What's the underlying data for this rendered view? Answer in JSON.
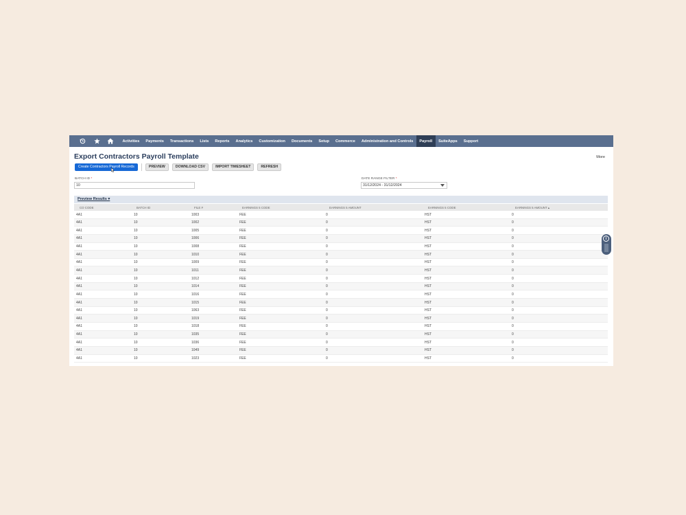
{
  "nav": {
    "icons": [
      "recent-icon",
      "star-icon",
      "home-icon"
    ],
    "items": [
      {
        "label": "Activities",
        "active": false
      },
      {
        "label": "Payments",
        "active": false
      },
      {
        "label": "Transactions",
        "active": false
      },
      {
        "label": "Lists",
        "active": false
      },
      {
        "label": "Reports",
        "active": false
      },
      {
        "label": "Analytics",
        "active": false
      },
      {
        "label": "Customization",
        "active": false
      },
      {
        "label": "Documents",
        "active": false
      },
      {
        "label": "Setup",
        "active": false
      },
      {
        "label": "Commerce",
        "active": false
      },
      {
        "label": "Administration and Controls",
        "active": false
      },
      {
        "label": "Payroll",
        "active": true
      },
      {
        "label": "SuiteApps",
        "active": false
      },
      {
        "label": "Support",
        "active": false
      }
    ]
  },
  "page": {
    "title": "Export Contractors Payroll Template",
    "more": "More"
  },
  "buttons": {
    "create": "Create Contractors Payroll Records",
    "preview": "PREVIEW",
    "download": "DOWNLOAD CSV",
    "import": "IMPORT TIMESHEET",
    "refresh": "REFRESH"
  },
  "fields": {
    "batch_id_label": "BATCH ID",
    "batch_id_value": "10",
    "date_range_label": "DATE RANGE FILTER",
    "date_range_value": "31/12/2024 - 31/12/2024",
    "required_mark": "*"
  },
  "preview": {
    "title": "Preview Results",
    "title_caret": "▾",
    "columns": [
      "CO CODE",
      "BATCH ID",
      "FILE #",
      "EARNINGS 5 CODE",
      "EARNINGS 5 AMOUNT",
      "EARNINGS 5 CODE",
      "EARNINGS 5 AMOUNT ▴"
    ],
    "rows": [
      [
        "4A1",
        "10",
        "1003",
        "FEE",
        "0",
        "HST",
        "0"
      ],
      [
        "4A1",
        "10",
        "1002",
        "FEE",
        "0",
        "HST",
        "0"
      ],
      [
        "4A1",
        "10",
        "1005",
        "FEE",
        "0",
        "HST",
        "0"
      ],
      [
        "4A1",
        "10",
        "1006",
        "FEE",
        "0",
        "HST",
        "0"
      ],
      [
        "4A1",
        "10",
        "1008",
        "FEE",
        "0",
        "HST",
        "0"
      ],
      [
        "4A1",
        "10",
        "1010",
        "FEE",
        "0",
        "HST",
        "0"
      ],
      [
        "4A1",
        "10",
        "1009",
        "FEE",
        "0",
        "HST",
        "0"
      ],
      [
        "4A1",
        "10",
        "1011",
        "FEE",
        "0",
        "HST",
        "0"
      ],
      [
        "4A1",
        "10",
        "1012",
        "FEE",
        "0",
        "HST",
        "0"
      ],
      [
        "4A1",
        "10",
        "1014",
        "FEE",
        "0",
        "HST",
        "0"
      ],
      [
        "4A1",
        "10",
        "1016",
        "FEE",
        "0",
        "HST",
        "0"
      ],
      [
        "4A1",
        "10",
        "1015",
        "FEE",
        "0",
        "HST",
        "0"
      ],
      [
        "4A1",
        "10",
        "1063",
        "FEE",
        "0",
        "HST",
        "0"
      ],
      [
        "4A1",
        "10",
        "1019",
        "FEE",
        "0",
        "HST",
        "0"
      ],
      [
        "4A1",
        "10",
        "1018",
        "FEE",
        "0",
        "HST",
        "0"
      ],
      [
        "4A1",
        "10",
        "1035",
        "FEE",
        "0",
        "HST",
        "0"
      ],
      [
        "4A1",
        "10",
        "1036",
        "FEE",
        "0",
        "HST",
        "0"
      ],
      [
        "4A1",
        "10",
        "1049",
        "FEE",
        "0",
        "HST",
        "0"
      ],
      [
        "4A1",
        "10",
        "1023",
        "FEE",
        "0",
        "HST",
        "0"
      ]
    ]
  },
  "side_widget": {
    "icon": "info-icon",
    "glyph": "i"
  },
  "colors": {
    "nav": "#5a6f8f",
    "nav_active": "#2f3e56",
    "primary": "#1769d6",
    "title": "#2a3d5c"
  }
}
